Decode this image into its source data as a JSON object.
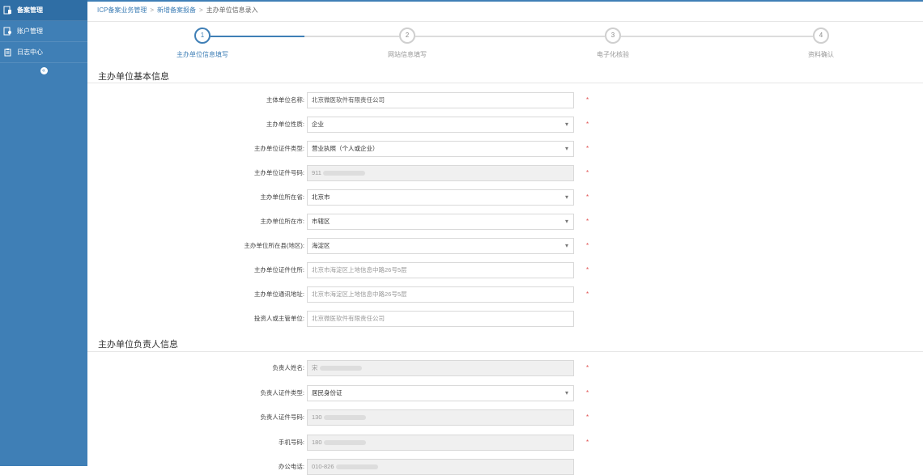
{
  "sidebar": {
    "items": [
      {
        "label": "备案管理",
        "icon": "filing-icon",
        "active": true
      },
      {
        "label": "账户管理",
        "icon": "account-icon",
        "active": false
      },
      {
        "label": "日志中心",
        "icon": "log-icon",
        "active": false
      }
    ],
    "collapse_label": "«"
  },
  "breadcrumb": {
    "items": [
      "ICP备案业务管理",
      "新增备案报备",
      "主办单位信息录入"
    ],
    "separator": ">"
  },
  "steps": [
    {
      "num": "1",
      "label": "主办单位信息填写",
      "active": true
    },
    {
      "num": "2",
      "label": "网站信息填写",
      "active": false
    },
    {
      "num": "3",
      "label": "电子化核验",
      "active": false
    },
    {
      "num": "4",
      "label": "资料确认",
      "active": false
    }
  ],
  "section1": {
    "title": "主办单位基本信息",
    "fields": [
      {
        "label": "主体单位名称:",
        "value": "北京微医软件有限责任公司",
        "type": "text",
        "required": true
      },
      {
        "label": "主办单位性质:",
        "value": "企业",
        "type": "select",
        "required": true
      },
      {
        "label": "主办单位证件类型:",
        "value": "营业执照（个人或企业）",
        "type": "select",
        "required": true
      },
      {
        "label": "主办单位证件号码:",
        "value": "911",
        "type": "masked",
        "required": true
      },
      {
        "label": "主办单位所在省:",
        "value": "北京市",
        "type": "select",
        "required": true
      },
      {
        "label": "主办单位所在市:",
        "value": "市辖区",
        "type": "select",
        "required": true
      },
      {
        "label": "主办单位所在县(地区):",
        "value": "海淀区",
        "type": "select",
        "required": true
      },
      {
        "label": "主办单位证件住所:",
        "value": "北京市海淀区上地信息中路26号5层",
        "type": "text",
        "required": true
      },
      {
        "label": "主办单位通讯地址:",
        "value": "北京市海淀区上地信息中路26号5层",
        "type": "text",
        "required": true
      },
      {
        "label": "投资人或主管单位:",
        "value": "北京微医软件有限责任公司",
        "type": "text",
        "required": false
      }
    ]
  },
  "section2": {
    "title": "主办单位负责人信息",
    "fields": [
      {
        "label": "负责人姓名:",
        "value": "宋",
        "type": "masked",
        "required": true
      },
      {
        "label": "负责人证件类型:",
        "value": "居民身份证",
        "type": "select",
        "required": true
      },
      {
        "label": "负责人证件号码:",
        "value": "130",
        "type": "masked",
        "required": true
      },
      {
        "label": "手机号码:",
        "value": "180",
        "type": "masked",
        "required": true
      },
      {
        "label": "办公电话:",
        "value": "010-826",
        "type": "masked",
        "required": false
      }
    ]
  },
  "required_mark": "*",
  "colors": {
    "accent": "#3f7fb6",
    "sidebar": "#3f7fb6",
    "required": "#e04b4b"
  }
}
